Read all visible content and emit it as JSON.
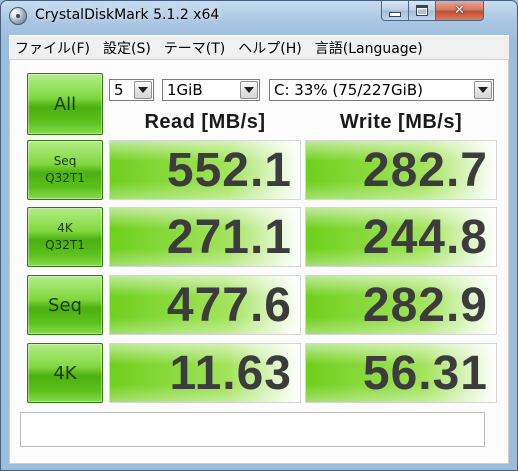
{
  "window": {
    "title": "CrystalDiskMark 5.1.2 x64",
    "min_label": "minimize",
    "max_label": "maximize",
    "close_label": "close"
  },
  "menu": [
    {
      "label": "ファイル(F)"
    },
    {
      "label": "設定(S)"
    },
    {
      "label": "テーマ(T)"
    },
    {
      "label": "ヘルプ(H)"
    },
    {
      "label": "言語(Language)"
    }
  ],
  "controls": {
    "all_button": "All",
    "count_select": "5",
    "size_select": "1GiB",
    "drive_select": "C: 33% (75/227GiB)"
  },
  "headers": {
    "read": "Read [MB/s]",
    "write": "Write [MB/s]"
  },
  "tests": [
    {
      "label_line1": "Seq",
      "label_line2": "Q32T1",
      "read": "552.1",
      "write": "282.7"
    },
    {
      "label_line1": "4K",
      "label_line2": "Q32T1",
      "read": "271.1",
      "write": "244.8"
    },
    {
      "label_line1": "Seq",
      "label_line2": "",
      "read": "477.6",
      "write": "282.9"
    },
    {
      "label_line1": "4K",
      "label_line2": "",
      "read": "11.63",
      "write": "56.31"
    }
  ],
  "comment": "",
  "colors": {
    "button_green": "#5cc01c",
    "bar_green": "#6fd01d",
    "value_text": "#3c3c3c"
  }
}
